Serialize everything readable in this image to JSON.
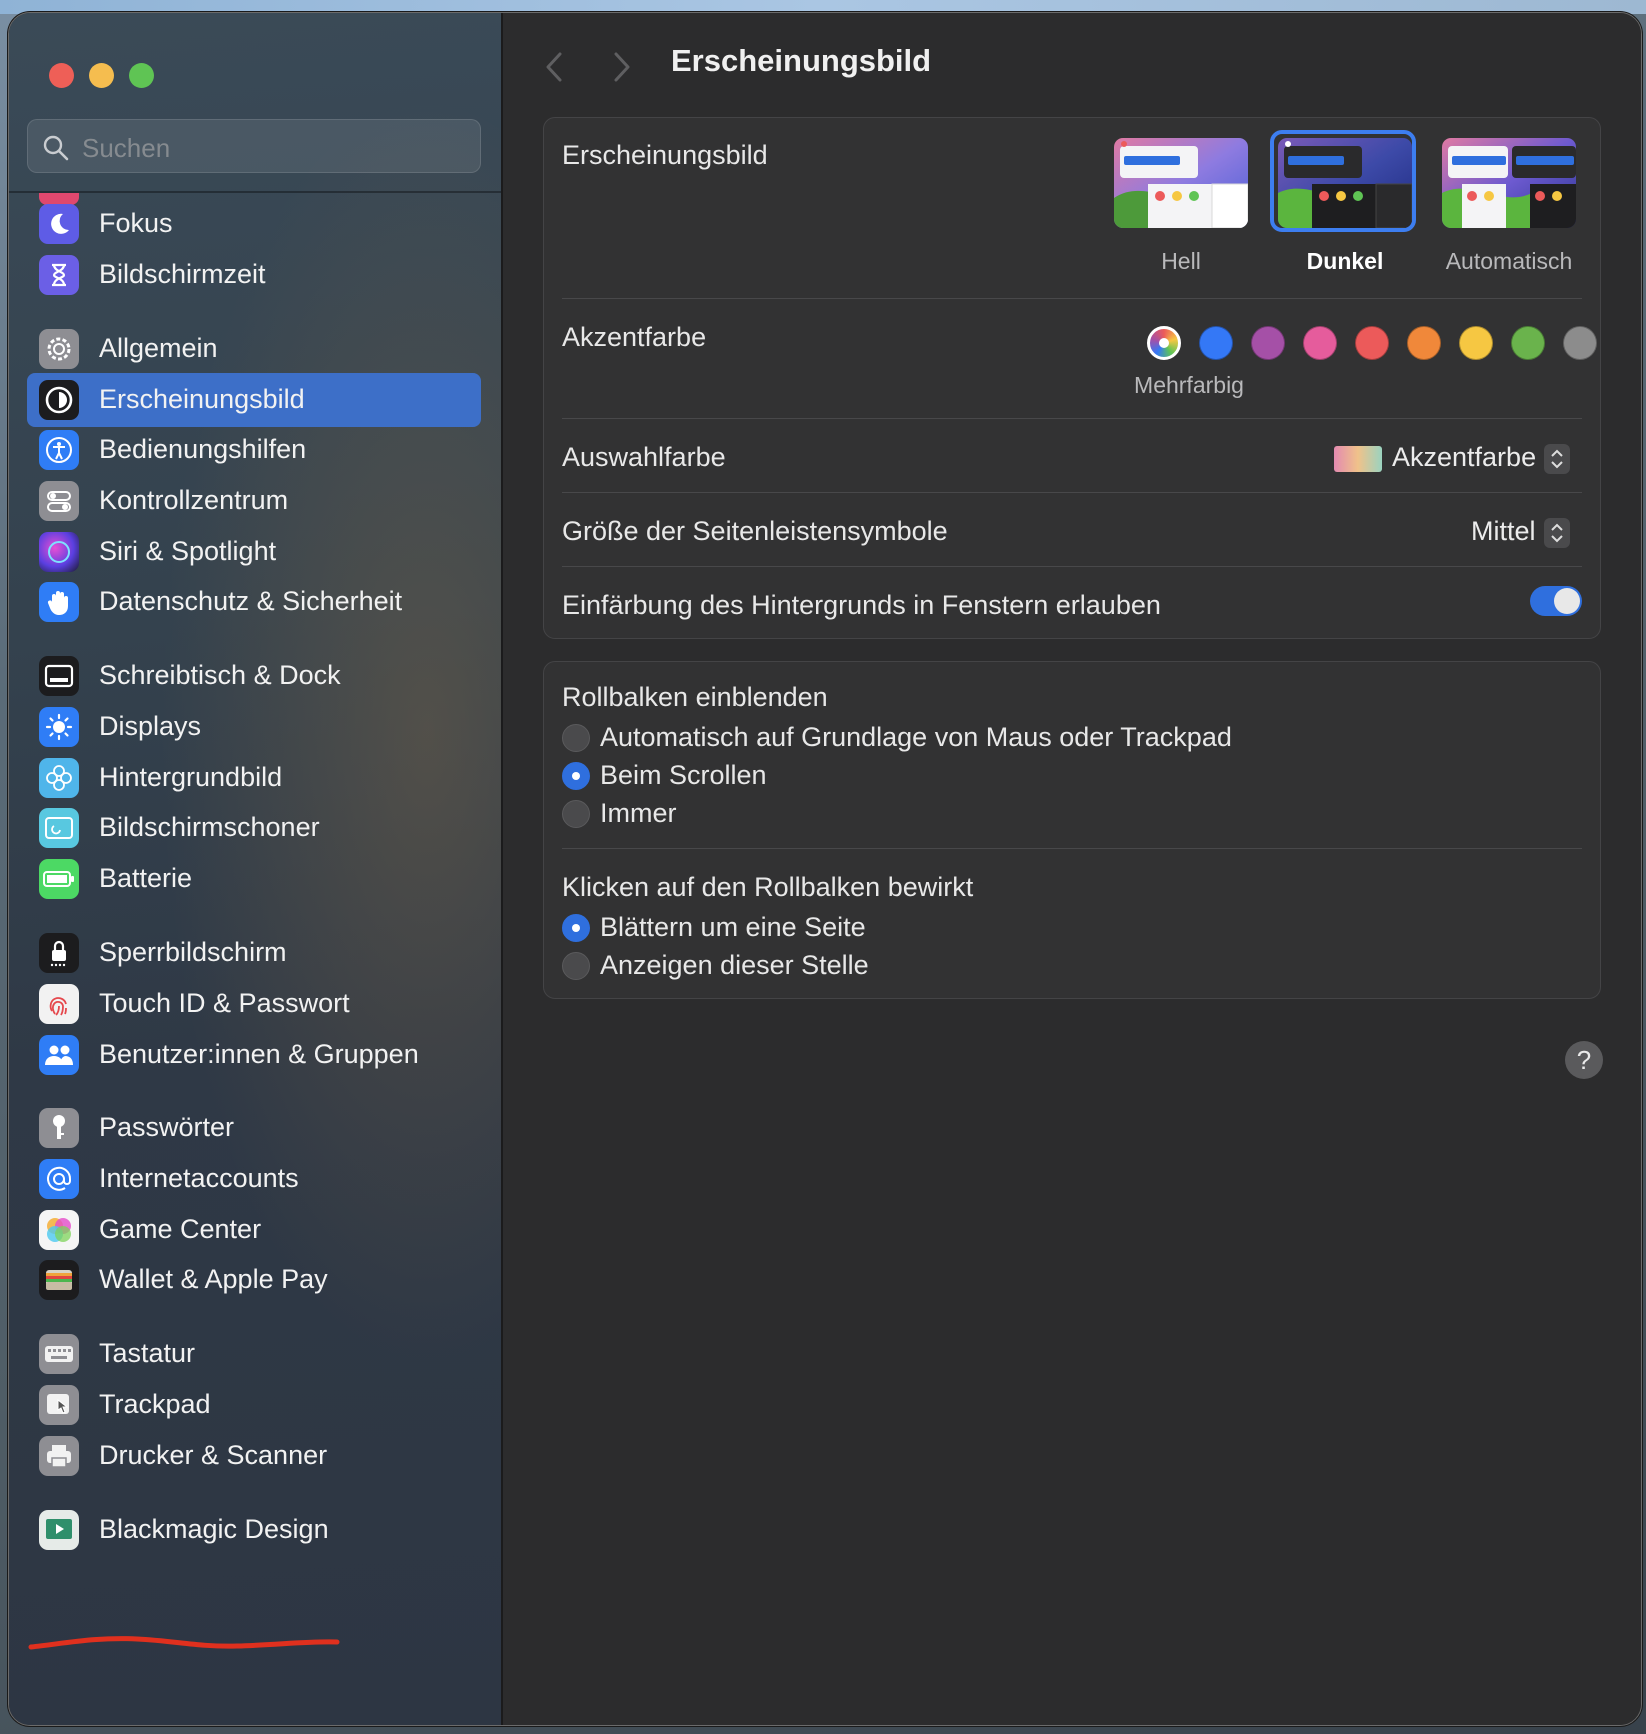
{
  "window": {
    "title": "Erscheinungsbild"
  },
  "search": {
    "placeholder": "Suchen"
  },
  "sidebar": {
    "items": [
      {
        "label": "Fokus",
        "icon": "moon-icon"
      },
      {
        "label": "Bildschirmzeit",
        "icon": "hourglass-icon"
      },
      {
        "label": "Allgemein",
        "icon": "gear-icon"
      },
      {
        "label": "Erscheinungsbild",
        "icon": "appearance-icon",
        "selected": true
      },
      {
        "label": "Bedienungshilfen",
        "icon": "accessibility-icon"
      },
      {
        "label": "Kontrollzentrum",
        "icon": "control-center-icon"
      },
      {
        "label": "Siri & Spotlight",
        "icon": "siri-icon"
      },
      {
        "label": "Datenschutz & Sicherheit",
        "icon": "hand-icon"
      },
      {
        "label": "Schreibtisch & Dock",
        "icon": "dock-icon"
      },
      {
        "label": "Displays",
        "icon": "sun-icon"
      },
      {
        "label": "Hintergrundbild",
        "icon": "flower-icon"
      },
      {
        "label": "Bildschirmschoner",
        "icon": "screensaver-icon"
      },
      {
        "label": "Batterie",
        "icon": "battery-icon"
      },
      {
        "label": "Sperrbildschirm",
        "icon": "lock-icon"
      },
      {
        "label": "Touch ID & Passwort",
        "icon": "fingerprint-icon"
      },
      {
        "label": "Benutzer:innen & Gruppen",
        "icon": "users-icon"
      },
      {
        "label": "Passwörter",
        "icon": "key-icon"
      },
      {
        "label": "Internetaccounts",
        "icon": "at-icon"
      },
      {
        "label": "Game Center",
        "icon": "game-center-icon"
      },
      {
        "label": "Wallet & Apple Pay",
        "icon": "wallet-icon"
      },
      {
        "label": "Tastatur",
        "icon": "keyboard-icon"
      },
      {
        "label": "Trackpad",
        "icon": "trackpad-icon"
      },
      {
        "label": "Drucker & Scanner",
        "icon": "printer-icon"
      },
      {
        "label": "Blackmagic Design",
        "icon": "blackmagic-icon"
      }
    ]
  },
  "appearance": {
    "label": "Erscheinungsbild",
    "options": [
      "Hell",
      "Dunkel",
      "Automatisch"
    ],
    "selected": "Dunkel"
  },
  "accent": {
    "label": "Akzentfarbe",
    "caption": "Mehrfarbig",
    "colors": [
      "multicolor",
      "#3478f6",
      "#a550a7",
      "#e55c9c",
      "#ec5a5a",
      "#f0883a",
      "#f6c742",
      "#6ab34c",
      "#8c8c8c"
    ],
    "selected": "multicolor"
  },
  "highlight": {
    "label": "Auswahlfarbe",
    "value": "Akzentfarbe"
  },
  "sidebar_icon_size": {
    "label": "Größe der Seitenleistensymbole",
    "value": "Mittel"
  },
  "wallpaper_tinting": {
    "label": "Einfärbung des Hintergrunds in Fenstern erlauben",
    "enabled": true
  },
  "scrollbars": {
    "label": "Rollbalken einblenden",
    "options": [
      "Automatisch auf Grundlage von Maus oder Trackpad",
      "Beim Scrollen",
      "Immer"
    ],
    "selected": "Beim Scrollen"
  },
  "scroll_click": {
    "label": "Klicken auf den Rollbalken bewirkt",
    "options": [
      "Blättern um eine Seite",
      "Anzeigen dieser Stelle"
    ],
    "selected": "Blättern um eine Seite"
  },
  "help": {
    "label": "?"
  },
  "colors": {
    "sidebar_selection": "#3d6fc8",
    "toggle_on": "#2f6fde",
    "annotation_underline": "#e0301e"
  }
}
